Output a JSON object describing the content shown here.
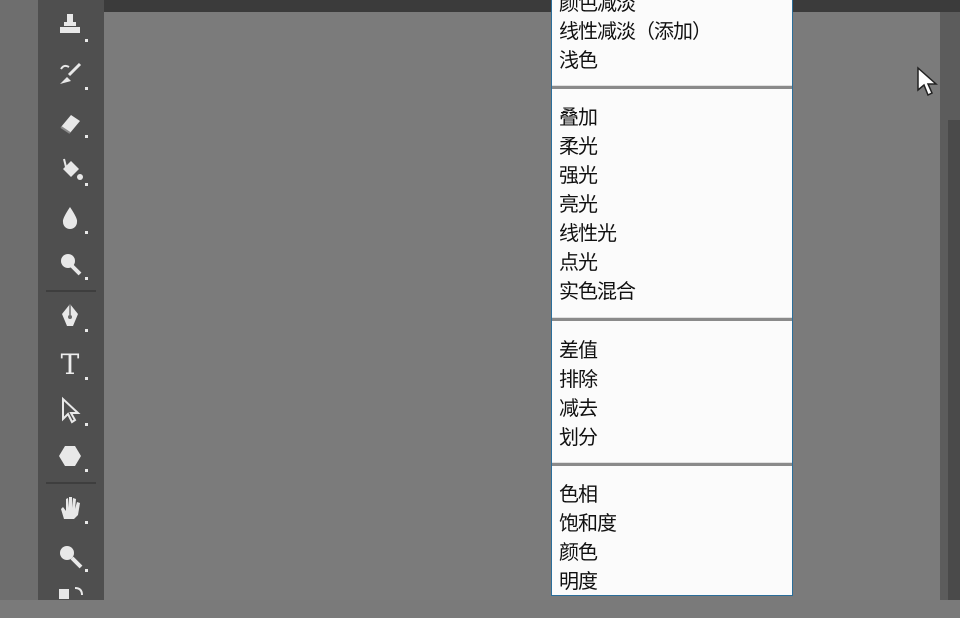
{
  "toolbar": {
    "tools": [
      {
        "name": "clone-stamp-icon"
      },
      {
        "name": "history-brush-icon"
      },
      {
        "name": "eraser-icon"
      },
      {
        "name": "paint-bucket-icon"
      },
      {
        "name": "blur-icon"
      },
      {
        "name": "dodge-icon"
      },
      {
        "name": "pen-icon"
      },
      {
        "name": "type-icon",
        "glyph": "T"
      },
      {
        "name": "path-selection-icon"
      },
      {
        "name": "shape-icon"
      },
      {
        "name": "hand-icon"
      },
      {
        "name": "zoom-icon"
      },
      {
        "name": "default-colors-icon"
      }
    ]
  },
  "blend_menu": {
    "groups": [
      {
        "items": [
          "颜色减淡",
          "线性减淡（添加）",
          "浅色"
        ]
      },
      {
        "items": [
          "叠加",
          "柔光",
          "强光",
          "亮光",
          "线性光",
          "点光",
          "实色混合"
        ]
      },
      {
        "items": [
          "差值",
          "排除",
          "减去",
          "划分"
        ]
      },
      {
        "items": [
          "色相",
          "饱和度",
          "颜色",
          "明度"
        ]
      }
    ]
  },
  "colors": {
    "canvas": "#7b7b7b",
    "menu_bg": "#fbfbfb",
    "menu_border": "#2b6e9a"
  }
}
